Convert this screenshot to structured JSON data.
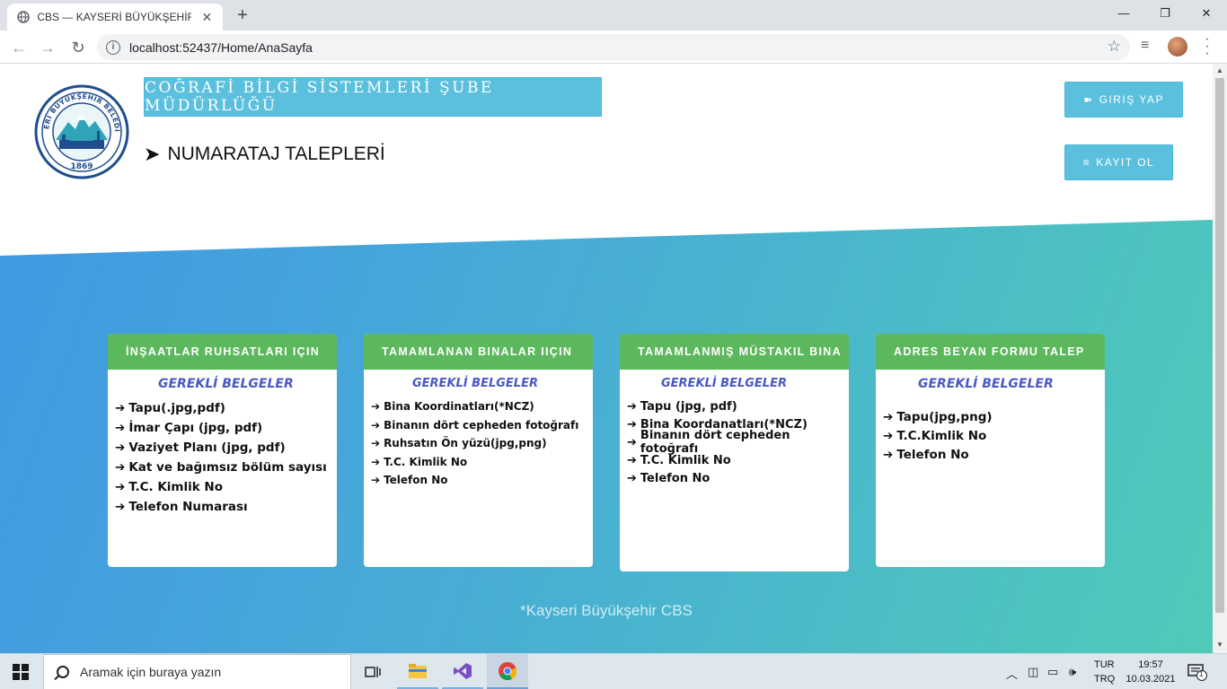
{
  "browser": {
    "tab_title": "CBS — KAYSERİ BÜYÜKŞEHİR CO",
    "close_tab": "✕",
    "new_tab": "+",
    "url": "localhost:52437/Home/AnaSayfa",
    "minimize": "—",
    "maximize": "❐",
    "close_window": "✕"
  },
  "header": {
    "logo_alt_text": "KAYSERİ BÜYÜKŞEHİR BELEDİYESİ",
    "logo_year": "1869",
    "title": "COĞRAFİ BİLGİ SİSTEMLERİ ŞUBE MÜDÜRLÜĞÜ",
    "subtitle": "NUMARATAJ TALEPLERİ",
    "login_label": "GIRIŞ YAP",
    "register_label": "KAYIT OL"
  },
  "cards": [
    {
      "header": "İNŞAATLAR RUHSATLARI IÇIN",
      "section_title": "GEREKLİ BELGELER",
      "items": [
        "Tapu(.jpg,pdf)",
        "İmar Çapı (jpg, pdf)",
        "Vaziyet Planı (jpg, pdf)",
        "Kat ve bağımsız bölüm sayısı",
        "T.C. Kimlik No",
        "Telefon Numarası"
      ]
    },
    {
      "header": "TAMAMLANAN BINALAR IIÇIN",
      "section_title": "GEREKLİ BELGELER",
      "items": [
        "Bina Koordinatları(*NCZ)",
        "Binanın dört cepheden fotoğrafı",
        "Ruhsatın Ön yüzü(jpg,png)",
        "T.C. Kimlik No",
        "Telefon No"
      ]
    },
    {
      "header": "TAMAMLANMIŞ MÜSTAKIL BINA",
      "section_title": "GEREKLİ BELGELER",
      "items": [
        "Tapu (jpg, pdf)",
        "Bina Koordanatları(*NCZ)",
        "Binanın dört cepheden fotoğrafı",
        "T.C. Kimlik  No",
        "Telefon No"
      ]
    },
    {
      "header": "ADRES BEYAN FORMU TALEP",
      "section_title": "GEREKLİ BELGELER",
      "items": [
        "Tapu(jpg,png)",
        "T.C.Kimlik No",
        "Telefon No"
      ]
    }
  ],
  "footer_note": "*Kayseri Büyükşehir CBS",
  "taskbar": {
    "search_placeholder": "Aramak için buraya yazın",
    "lang_1": "TUR",
    "lang_2": "TRQ",
    "time": "19:57",
    "date": "10.03.2021",
    "notification_count": "1"
  },
  "colors": {
    "accent_info": "#5bc0de",
    "card_header": "#5cb85c",
    "gradient_start": "#3f97e3",
    "gradient_end": "#4fcbb8"
  }
}
